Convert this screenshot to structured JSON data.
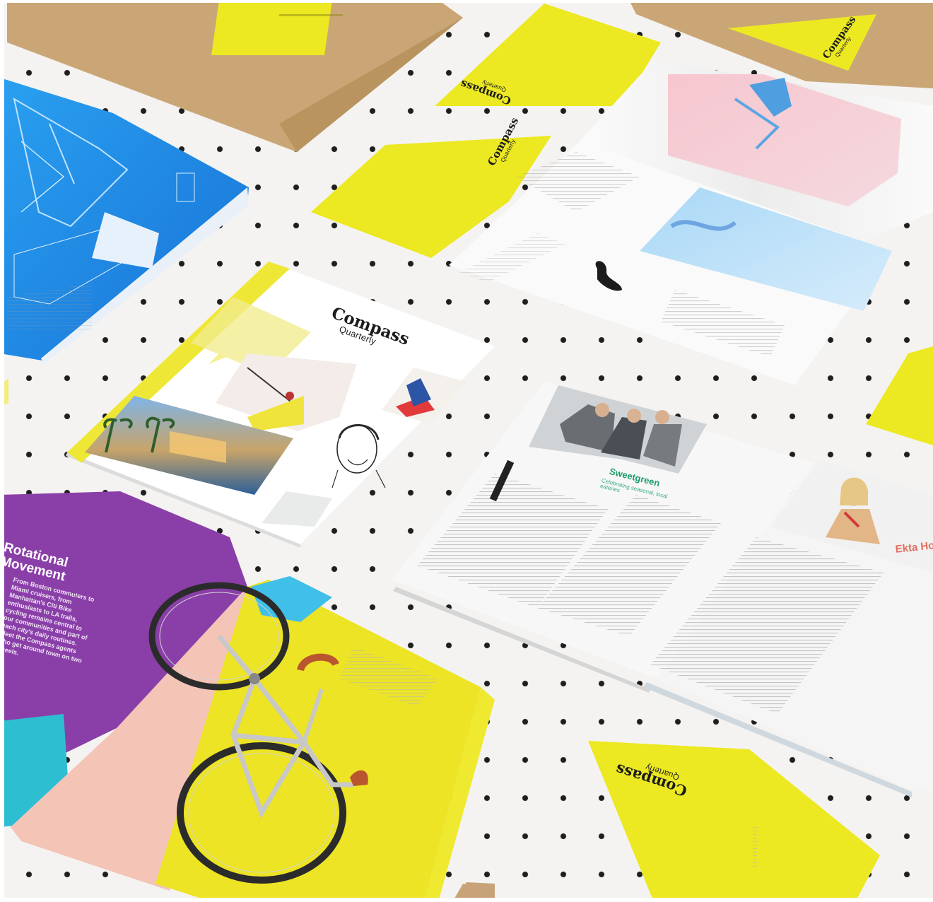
{
  "colors": {
    "background": "#f4f3f1",
    "dots": "#1e1e1e",
    "brand_yellow": "#eee824",
    "cardboard": "#c9a878",
    "cover_blue": "#1e8ee6",
    "spread_purple": "#8a3fa8",
    "accent_green": "#1f9d6b",
    "accent_coral": "#e46d5e"
  },
  "brand": {
    "name": "Compass",
    "subtitle": "Quarterly"
  },
  "purple_spread": {
    "headline_line1": "Rotational",
    "headline_line2": "Movement",
    "intro": "From Boston commuters to Miami cruisers, from Manhattan's Citi Bike enthusiasts to LA trails, cycling remains central to our communities and part of each city's daily routines. Meet the Compass agents who get around town on two wheels."
  },
  "sweetgreen_article": {
    "title": "Sweetgreen",
    "tagline": "Celebrating seasonal, local eateries"
  },
  "right_feature": {
    "name": "Ekta Ho"
  },
  "icons": {
    "bicycle": "bicycle-icon",
    "portrait_sketch": "portrait-sketch-icon"
  }
}
